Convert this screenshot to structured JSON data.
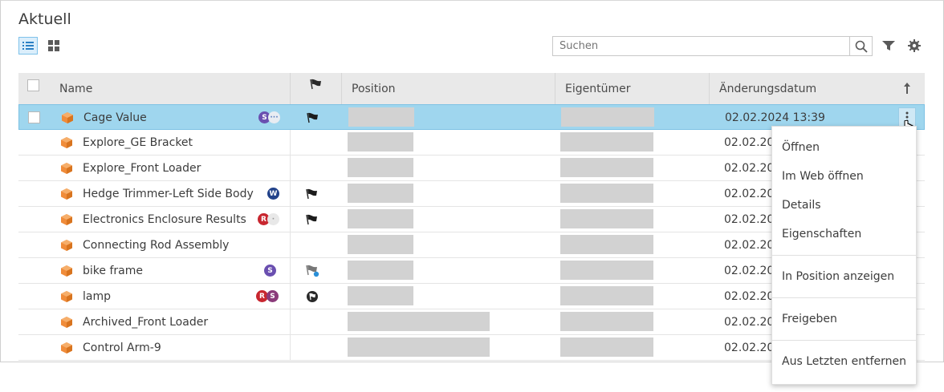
{
  "page": {
    "title": "Aktuell",
    "search_placeholder": "Suchen"
  },
  "icons": {
    "list_view": "list-view-icon",
    "grid_view": "grid-view-icon",
    "search": "search-icon",
    "filter": "filter-icon",
    "settings": "gear-icon",
    "sort": "arrow-up-icon",
    "part": "cube-icon",
    "flag": "flag-icon",
    "more": "more-vertical-icon",
    "cursor": "hand-cursor-icon"
  },
  "colors": {
    "selected_row": "#9fd6ee",
    "cube": "#f08c3a",
    "redaction": "#d2d2d2"
  },
  "table": {
    "columns": {
      "name": "Name",
      "position": "Position",
      "owner": "Eigentümer",
      "modified": "Änderungsdatum"
    },
    "rows": [
      {
        "name": "Cage Value",
        "modified": "02.02.2024 13:39"
      },
      {
        "name": "Explore_GE Bracket",
        "modified": "02.02.202"
      },
      {
        "name": "Explore_Front Loader",
        "modified": "02.02.202"
      },
      {
        "name": "Hedge Trimmer-Left Side Body",
        "modified": "02.02.202"
      },
      {
        "name": "Electronics Enclosure Results",
        "modified": "02.02.202"
      },
      {
        "name": "Connecting Rod Assembly",
        "modified": "02.02.202"
      },
      {
        "name": "bike frame",
        "modified": "02.02.202"
      },
      {
        "name": "lamp",
        "modified": "02.02.202"
      },
      {
        "name": "Archived_Front Loader",
        "modified": "02.02.202"
      },
      {
        "name": "Control Arm-9",
        "modified": "02.02.202"
      }
    ]
  },
  "badges": {
    "r0": "S",
    "r3": "W",
    "r4": "R",
    "r6": "S",
    "r7a": "R",
    "r7b": "S"
  },
  "context_menu": {
    "open": "Öffnen",
    "open_web": "Im Web öffnen",
    "details": "Details",
    "properties": "Eigenschaften",
    "show_location": "In Position anzeigen",
    "share": "Freigeben",
    "remove_recent": "Aus Letzten entfernen"
  }
}
